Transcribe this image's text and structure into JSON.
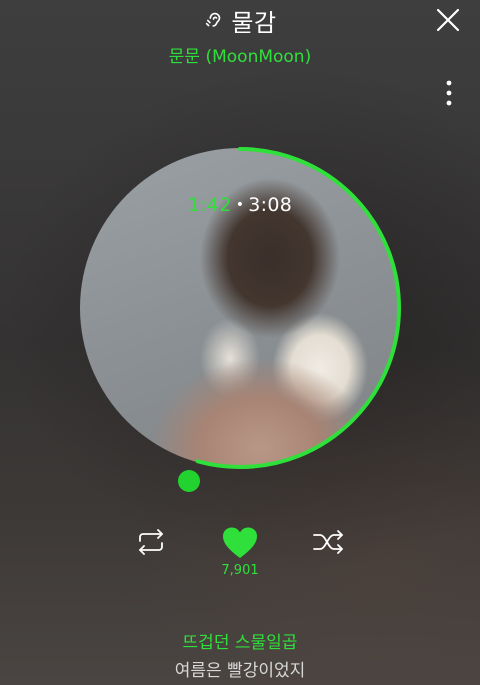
{
  "header": {
    "title": "물감",
    "artist": "문문 (MoonMoon)",
    "title_icon": "hearing-icon",
    "close_icon": "close-icon",
    "more_icon": "more-vertical-icon"
  },
  "player": {
    "elapsed": "1:42",
    "separator": "•",
    "total": "3:08",
    "progress_fraction": 0.5426
  },
  "controls": {
    "repeat_icon": "repeat-icon",
    "like_icon": "heart-icon",
    "like_count": "7,901",
    "shuffle_icon": "shuffle-icon"
  },
  "lyrics": {
    "current": "뜨겁던 스물일곱",
    "next": "여름은 빨강이었지"
  },
  "colors": {
    "accent": "#2fe03b",
    "text": "#ffffff",
    "muted_text": "#d8d8d8"
  }
}
